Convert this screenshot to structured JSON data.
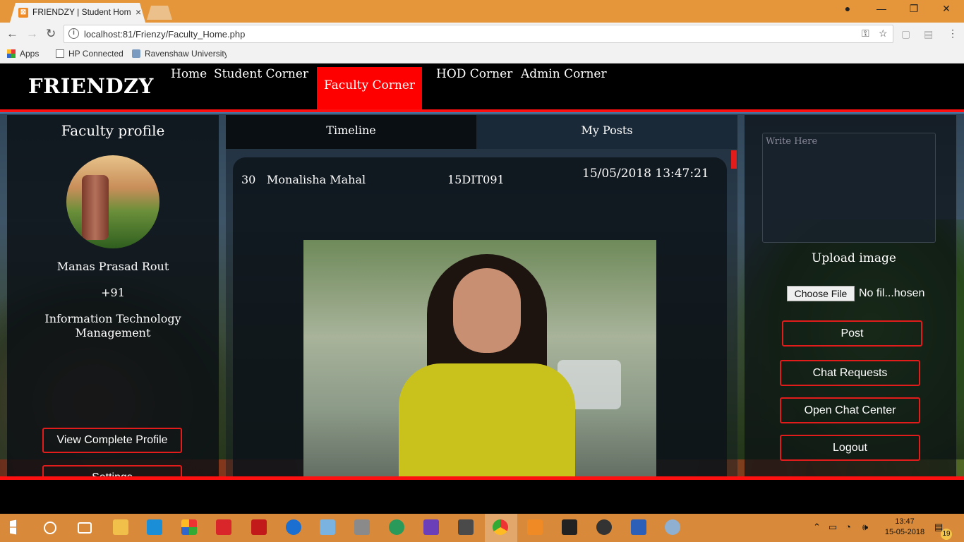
{
  "browser": {
    "tab_title": "FRIENDZY | Student Hom",
    "url": "localhost:81/Frienzy/Faculty_Home.php",
    "bookmarks": [
      "Apps",
      "HP Connected",
      "Ravenshaw University"
    ]
  },
  "header": {
    "brand": "FRIENDZY",
    "nav": [
      "Home",
      "Student Corner",
      "Faculty Corner",
      "HOD Corner",
      "Admin Corner"
    ],
    "active": "Faculty Corner"
  },
  "profile": {
    "title": "Faculty profile",
    "name": "Manas Prasad Rout",
    "phone": "+91",
    "department": "Information Technology Management",
    "view_profile_label": "View Complete Profile",
    "settings_label": "Settings"
  },
  "feed": {
    "tabs": [
      "Timeline",
      "My Posts"
    ],
    "post": {
      "id": "30",
      "author": "Monalisha Mahal",
      "roll": "15DIT091",
      "timestamp": "15/05/2018 13:47:21"
    }
  },
  "compose": {
    "placeholder": "Write Here",
    "upload_label": "Upload image",
    "choose_file_label": "Choose File",
    "file_status": "No fil...hosen",
    "actions": [
      "Post",
      "Chat Requests",
      "Open Chat Center",
      "Logout"
    ]
  },
  "taskbar": {
    "time": "13:47",
    "date": "15-05-2018",
    "notifications": "19"
  },
  "colors": {
    "accent": "#ff0000",
    "titlebar": "#e5953a",
    "taskbar": "#d88a3a"
  }
}
